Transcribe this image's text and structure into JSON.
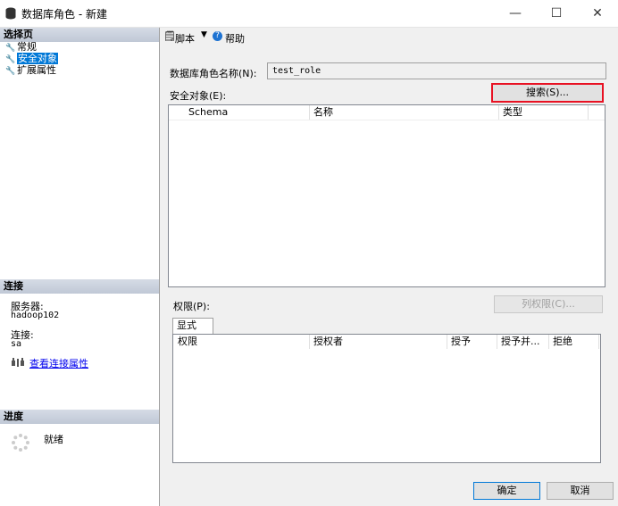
{
  "window": {
    "title": "数据库角色 - 新建",
    "minimize": "—",
    "maximize": "☐",
    "close": "✕"
  },
  "left": {
    "select_page": {
      "header": "选择页",
      "items": [
        {
          "label": "常规"
        },
        {
          "label": "安全对象"
        },
        {
          "label": "扩展属性"
        }
      ]
    },
    "connection": {
      "header": "连接",
      "server_label": "服务器:",
      "server_value": "hadoop102",
      "connection_label": "连接:",
      "connection_value": "sa",
      "view_link": "查看连接属性"
    },
    "progress": {
      "header": "进度",
      "status": "就绪"
    }
  },
  "toolbar": {
    "script_label": "脚本",
    "help_label": "帮助"
  },
  "form": {
    "role_name_label": "数据库角色名称(N):",
    "role_name_value": "test_role",
    "securables_label": "安全对象(E):",
    "search_button": "搜索(S)...",
    "securables_columns": [
      "Schema",
      "名称",
      "类型"
    ],
    "permissions_label": "权限(P):",
    "column_permissions_button": "列权限(C)...",
    "tab_explicit": "显式",
    "permissions_columns": [
      "权限",
      "授权者",
      "授予",
      "授予并...",
      "拒绝"
    ]
  },
  "footer": {
    "ok_button": "确定",
    "cancel_button": "取消"
  },
  "colors": {
    "highlight": "#e81123",
    "selection": "#0078d7",
    "accent": "#0000ee"
  }
}
